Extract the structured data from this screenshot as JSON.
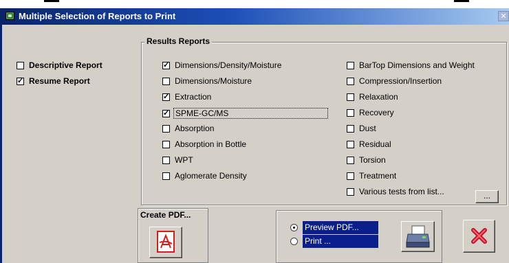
{
  "window": {
    "title": "Multiple Selection of Reports to Print",
    "close_glyph": "✕"
  },
  "left_options": [
    {
      "label": "Descriptive Report",
      "checked": false
    },
    {
      "label": "Resume Report",
      "checked": true
    }
  ],
  "results": {
    "title": "Results Reports",
    "col1": [
      {
        "label": "Dimensions/Density/Moisture",
        "checked": true
      },
      {
        "label": "Dimensions/Moisture",
        "checked": false
      },
      {
        "label": "Extraction",
        "checked": true
      },
      {
        "label": "SPME-GC/MS",
        "checked": true
      },
      {
        "label": "Absorption",
        "checked": false
      },
      {
        "label": "Absorption in Bottle",
        "checked": false
      },
      {
        "label": "WPT",
        "checked": false
      },
      {
        "label": "Aglomerate Density",
        "checked": false
      }
    ],
    "col2": [
      {
        "label": "BarTop Dimensions and Weight",
        "checked": false
      },
      {
        "label": "Compression/Insertion",
        "checked": false
      },
      {
        "label": "Relaxation",
        "checked": false
      },
      {
        "label": "Recovery",
        "checked": false
      },
      {
        "label": "Dust",
        "checked": false
      },
      {
        "label": "Residual",
        "checked": false
      },
      {
        "label": "Torsion",
        "checked": false
      },
      {
        "label": "Treatment",
        "checked": false
      },
      {
        "label": "Various tests from list...",
        "checked": false
      }
    ],
    "ellipsis_button": "..."
  },
  "create_pdf": {
    "label": "Create PDF..."
  },
  "output": {
    "options": [
      {
        "label": "Preview PDF...",
        "selected": true
      },
      {
        "label": "Print ...",
        "selected": false
      }
    ]
  },
  "colors": {
    "title_bar": "#0a246a",
    "selection": "#0a1e8c",
    "face": "#d4d0c8",
    "pdf_red": "#d11f1f",
    "cancel_red": "#c8102e"
  }
}
